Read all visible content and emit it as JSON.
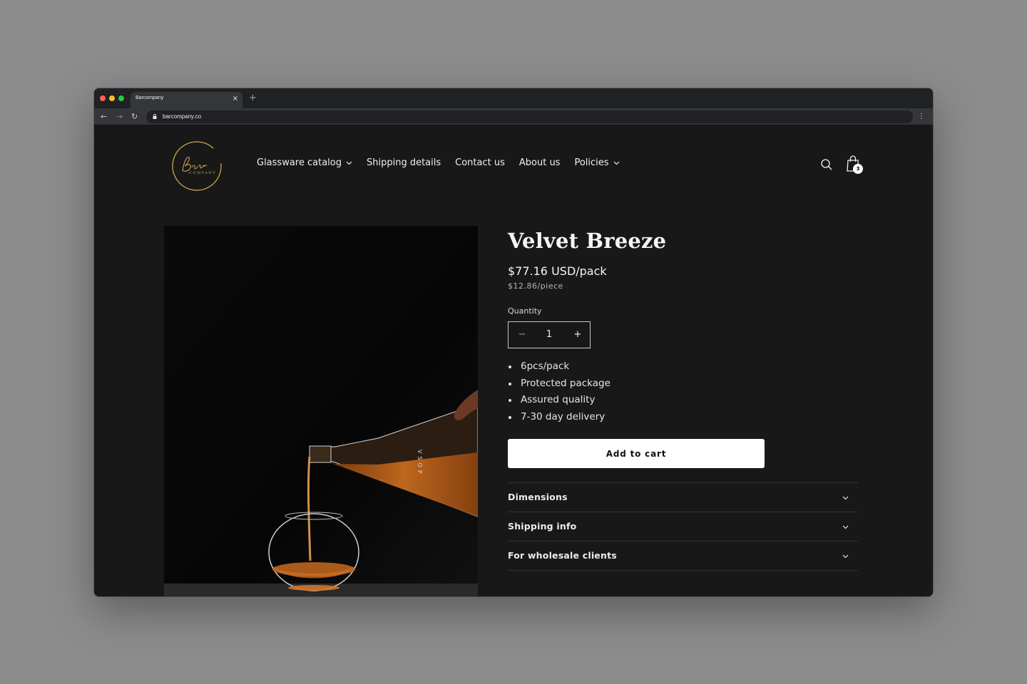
{
  "browser": {
    "tab_title": "Barcompany",
    "tab_close": "×",
    "new_tab": "+",
    "url": "barcompany.co"
  },
  "header": {
    "logo_alt": "Bar Company",
    "nav": [
      {
        "label": "Glassware catalog",
        "has_dropdown": true
      },
      {
        "label": "Shipping details",
        "has_dropdown": false
      },
      {
        "label": "Contact us",
        "has_dropdown": false
      },
      {
        "label": "About us",
        "has_dropdown": false
      },
      {
        "label": "Policies",
        "has_dropdown": true
      }
    ],
    "cart_count": "3"
  },
  "product": {
    "title": "Velvet Breeze",
    "price": "$77.16 USD/pack",
    "unit_price": "$12.86/piece",
    "quantity_label": "Quantity",
    "quantity": "1",
    "qty_minus": "−",
    "qty_plus": "+",
    "features": [
      "6pcs/pack",
      "Protected package",
      "Assured quality",
      "7-30 day delivery"
    ],
    "add_to_cart": "Add to cart",
    "accordion": [
      "Dimensions",
      "Shipping info",
      "For wholesale clients"
    ],
    "image_bottle_text": "VSOP"
  },
  "colors": {
    "page_bg": "#181818",
    "button_bg": "#ffffff",
    "logo_gold": "#c9a34a"
  }
}
